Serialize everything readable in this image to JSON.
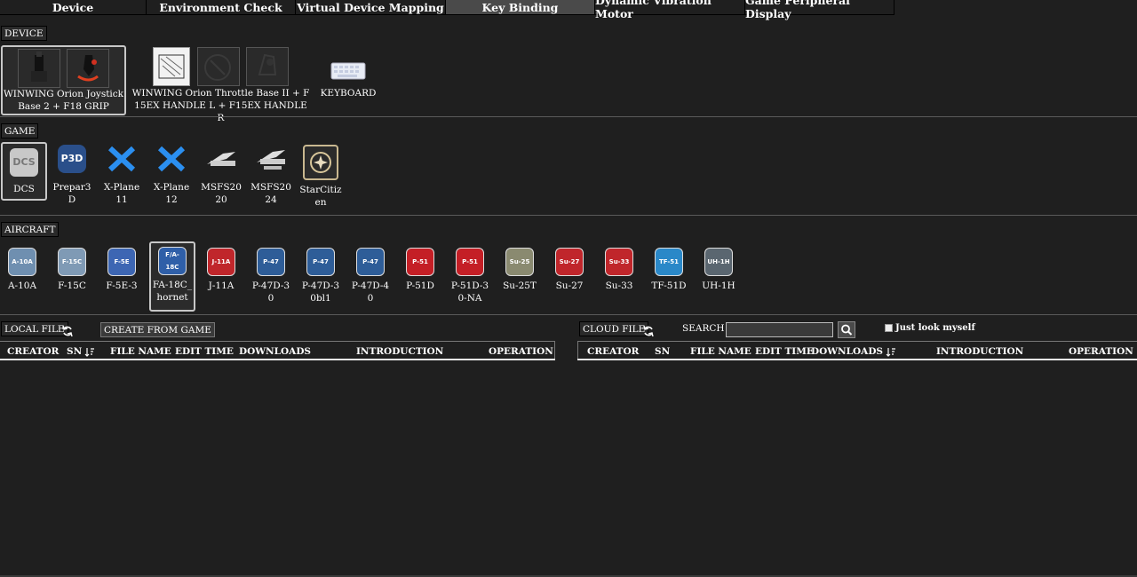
{
  "tabs": [
    {
      "label": "Device",
      "active": false
    },
    {
      "label": "Environment Check",
      "active": false
    },
    {
      "label": "Virtual Device Mapping",
      "active": false
    },
    {
      "label": "Key Binding",
      "active": true
    },
    {
      "label": "Dynamic Vibration Motor",
      "active": false
    },
    {
      "label": "Game Peripheral Display",
      "active": false
    }
  ],
  "device": {
    "section_label": "DEVICE",
    "items": [
      {
        "name": "WINWING Orion Joystick Base 2 + F18 GRIP",
        "selected": true
      },
      {
        "name": "WINWING Orion Throttle Base II + F15EX HANDLE L + F15EX HANDLE R",
        "selected": false
      },
      {
        "name": "KEYBOARD",
        "selected": false
      }
    ]
  },
  "game": {
    "section_label": "GAME",
    "items": [
      {
        "name": "DCS",
        "icon": "dcs-logo-icon",
        "selected": true
      },
      {
        "name": "Prepar3D",
        "icon": "p3d-logo-icon",
        "badge": "P3D",
        "selected": false
      },
      {
        "name": "X-Plane 11",
        "icon": "xplane-logo-icon",
        "selected": false
      },
      {
        "name": "X-Plane 12",
        "icon": "xplane-logo-icon",
        "selected": false
      },
      {
        "name": "MSFS2020",
        "icon": "msfs-logo-icon",
        "selected": false
      },
      {
        "name": "MSFS2024",
        "icon": "msfs-logo-icon",
        "selected": false
      },
      {
        "name": "StarCitizen",
        "icon": "starcitizen-logo-icon",
        "selected": false
      }
    ]
  },
  "aircraft": {
    "section_label": "AIRCRAFT",
    "items": [
      {
        "name": "A-10A",
        "badge": "A-10A",
        "color": "#6f8fb0",
        "selected": false
      },
      {
        "name": "F-15C",
        "badge": "F-15C",
        "color": "#7f9ab5",
        "selected": false
      },
      {
        "name": "F-5E-3",
        "badge": "F-5E",
        "color": "#3d66b3",
        "selected": false
      },
      {
        "name": "FA-18C_hornet",
        "badge": "F/A-18C",
        "color": "#2f5fa8",
        "selected": true
      },
      {
        "name": "J-11A",
        "badge": "J-11A",
        "color": "#c0262b",
        "selected": false
      },
      {
        "name": "P-47D-30",
        "badge": "P-47",
        "color": "#2e5d98",
        "selected": false
      },
      {
        "name": "P-47D-30bl1",
        "badge": "P-47",
        "color": "#2e5d98",
        "selected": false
      },
      {
        "name": "P-47D-40",
        "badge": "P-47",
        "color": "#2e5d98",
        "selected": false
      },
      {
        "name": "P-51D",
        "badge": "P-51",
        "color": "#c41f26",
        "selected": false
      },
      {
        "name": "P-51D-30-NA",
        "badge": "P-51",
        "color": "#c41f26",
        "selected": false
      },
      {
        "name": "Su-25T",
        "badge": "Su-25",
        "color": "#8a8a70",
        "selected": false
      },
      {
        "name": "Su-27",
        "badge": "Su-27",
        "color": "#c0262b",
        "selected": false
      },
      {
        "name": "Su-33",
        "badge": "Su-33",
        "color": "#c0262b",
        "selected": false
      },
      {
        "name": "TF-51D",
        "badge": "TF-51",
        "color": "#2a88c8",
        "selected": false
      },
      {
        "name": "UH-1H",
        "badge": "UH-1H",
        "color": "#5a6670",
        "selected": false
      }
    ]
  },
  "local_file": {
    "label": "LOCAL FILE",
    "create_button": "CREATE FROM GAME",
    "columns": [
      "CREATOR",
      "SN",
      "FILE NAME",
      "EDIT TIME",
      "DOWNLOADS",
      "INTRODUCTION",
      "OPERATION"
    ]
  },
  "cloud_file": {
    "label": "CLOUD FILE",
    "search_label": "SEARCH",
    "search_value": "",
    "just_look_myself": "Just look myself",
    "columns": [
      "CREATOR",
      "SN",
      "FILE NAME",
      "EDIT TIME",
      "DOWNLOADS",
      "INTRODUCTION",
      "OPERATION"
    ]
  }
}
